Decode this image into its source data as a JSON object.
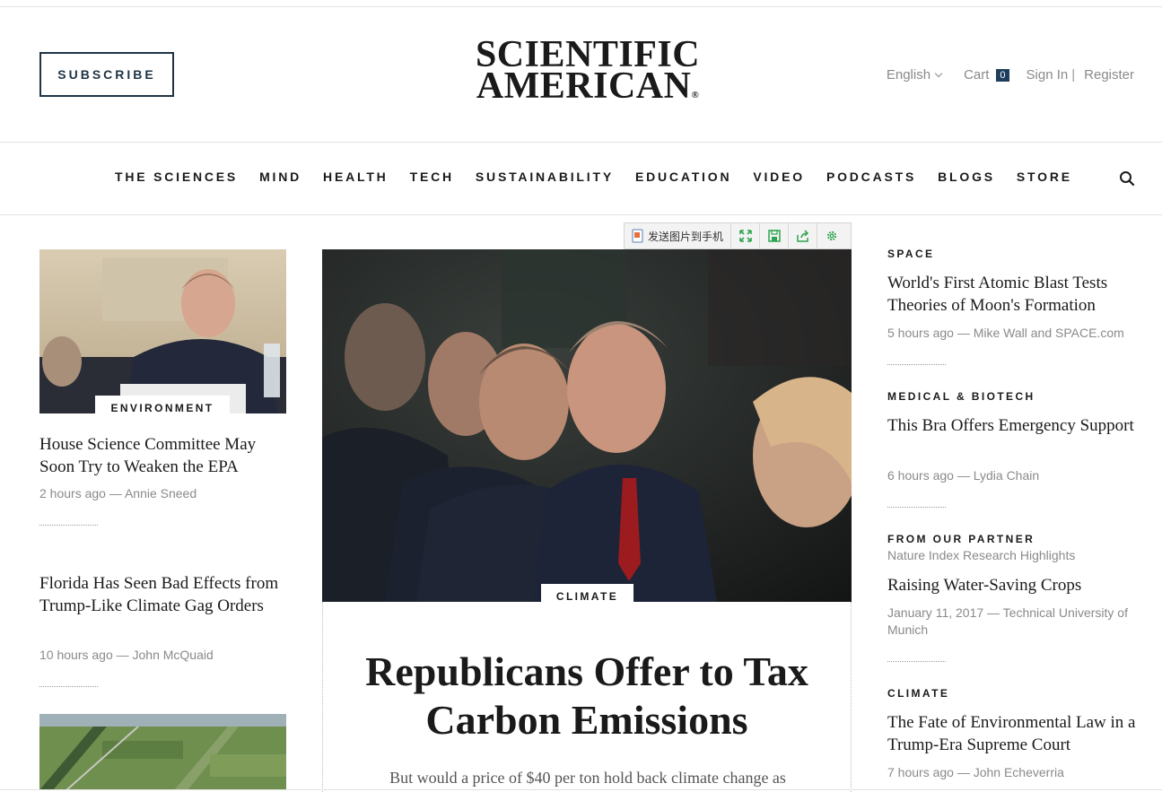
{
  "header": {
    "subscribe_label": "SUBSCRIBE",
    "logo_line1": "SCIENTIFIC",
    "logo_line2": "AMERICAN",
    "logo_mark": "®",
    "language": "English",
    "cart_label": "Cart",
    "cart_count": "0",
    "sign_in": "Sign In",
    "separator": "|",
    "register": "Register"
  },
  "nav": {
    "items": [
      "THE SCIENCES",
      "MIND",
      "HEALTH",
      "TECH",
      "SUSTAINABILITY",
      "EDUCATION",
      "VIDEO",
      "PODCASTS",
      "BLOGS",
      "STORE"
    ]
  },
  "toolbar": {
    "send_label": "发送图片到手机",
    "icons": [
      "expand-icon",
      "save-icon",
      "share-icon",
      "settings-icon"
    ]
  },
  "left": {
    "articles": [
      {
        "tag": "ENVIRONMENT",
        "title": "House Science Committee May Soon Try to Weaken the EPA",
        "meta": "2 hours ago — Annie Sneed"
      },
      {
        "title": "Florida Has Seen Bad Effects from Trump-Like Climate Gag Orders",
        "meta": "10 hours ago — John McQuaid"
      }
    ]
  },
  "feature": {
    "tag": "CLIMATE",
    "title": "Republicans Offer to Tax Carbon Emissions",
    "dek": "But would a price of $40 per ton hold back climate change as"
  },
  "right": {
    "articles": [
      {
        "category": "SPACE",
        "title": "World's First Atomic Blast Tests Theories of Moon's Formation",
        "meta": "5 hours ago — Mike Wall and SPACE.com"
      },
      {
        "category": "MEDICAL & BIOTECH",
        "title": "This Bra Offers Emergency Support",
        "meta": "6 hours ago — Lydia Chain"
      },
      {
        "category": "FROM OUR PARTNER",
        "subcategory": "Nature Index Research Highlights",
        "title": "Raising Water-Saving Crops",
        "meta": "January 11, 2017 — Technical University of Munich"
      },
      {
        "category": "CLIMATE",
        "title": "The Fate of Environmental Law in a Trump-Era Supreme Court",
        "meta": "7 hours ago — John Echeverria"
      }
    ]
  },
  "colors": {
    "brand_navy": "#1f3344",
    "cart_badge": "#1f3d5c",
    "meta_gray": "#8a8a8a"
  }
}
